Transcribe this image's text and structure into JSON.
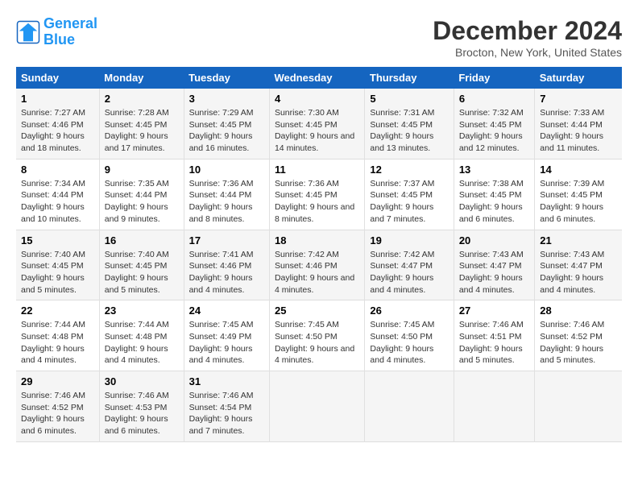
{
  "logo": {
    "line1": "General",
    "line2": "Blue"
  },
  "title": "December 2024",
  "subtitle": "Brocton, New York, United States",
  "days_of_week": [
    "Sunday",
    "Monday",
    "Tuesday",
    "Wednesday",
    "Thursday",
    "Friday",
    "Saturday"
  ],
  "weeks": [
    [
      {
        "day": "1",
        "sunrise": "7:27 AM",
        "sunset": "4:46 PM",
        "daylight": "9 hours and 18 minutes."
      },
      {
        "day": "2",
        "sunrise": "7:28 AM",
        "sunset": "4:45 PM",
        "daylight": "9 hours and 17 minutes."
      },
      {
        "day": "3",
        "sunrise": "7:29 AM",
        "sunset": "4:45 PM",
        "daylight": "9 hours and 16 minutes."
      },
      {
        "day": "4",
        "sunrise": "7:30 AM",
        "sunset": "4:45 PM",
        "daylight": "9 hours and 14 minutes."
      },
      {
        "day": "5",
        "sunrise": "7:31 AM",
        "sunset": "4:45 PM",
        "daylight": "9 hours and 13 minutes."
      },
      {
        "day": "6",
        "sunrise": "7:32 AM",
        "sunset": "4:45 PM",
        "daylight": "9 hours and 12 minutes."
      },
      {
        "day": "7",
        "sunrise": "7:33 AM",
        "sunset": "4:44 PM",
        "daylight": "9 hours and 11 minutes."
      }
    ],
    [
      {
        "day": "8",
        "sunrise": "7:34 AM",
        "sunset": "4:44 PM",
        "daylight": "9 hours and 10 minutes."
      },
      {
        "day": "9",
        "sunrise": "7:35 AM",
        "sunset": "4:44 PM",
        "daylight": "9 hours and 9 minutes."
      },
      {
        "day": "10",
        "sunrise": "7:36 AM",
        "sunset": "4:44 PM",
        "daylight": "9 hours and 8 minutes."
      },
      {
        "day": "11",
        "sunrise": "7:36 AM",
        "sunset": "4:45 PM",
        "daylight": "9 hours and 8 minutes."
      },
      {
        "day": "12",
        "sunrise": "7:37 AM",
        "sunset": "4:45 PM",
        "daylight": "9 hours and 7 minutes."
      },
      {
        "day": "13",
        "sunrise": "7:38 AM",
        "sunset": "4:45 PM",
        "daylight": "9 hours and 6 minutes."
      },
      {
        "day": "14",
        "sunrise": "7:39 AM",
        "sunset": "4:45 PM",
        "daylight": "9 hours and 6 minutes."
      }
    ],
    [
      {
        "day": "15",
        "sunrise": "7:40 AM",
        "sunset": "4:45 PM",
        "daylight": "9 hours and 5 minutes."
      },
      {
        "day": "16",
        "sunrise": "7:40 AM",
        "sunset": "4:45 PM",
        "daylight": "9 hours and 5 minutes."
      },
      {
        "day": "17",
        "sunrise": "7:41 AM",
        "sunset": "4:46 PM",
        "daylight": "9 hours and 4 minutes."
      },
      {
        "day": "18",
        "sunrise": "7:42 AM",
        "sunset": "4:46 PM",
        "daylight": "9 hours and 4 minutes."
      },
      {
        "day": "19",
        "sunrise": "7:42 AM",
        "sunset": "4:47 PM",
        "daylight": "9 hours and 4 minutes."
      },
      {
        "day": "20",
        "sunrise": "7:43 AM",
        "sunset": "4:47 PM",
        "daylight": "9 hours and 4 minutes."
      },
      {
        "day": "21",
        "sunrise": "7:43 AM",
        "sunset": "4:47 PM",
        "daylight": "9 hours and 4 minutes."
      }
    ],
    [
      {
        "day": "22",
        "sunrise": "7:44 AM",
        "sunset": "4:48 PM",
        "daylight": "9 hours and 4 minutes."
      },
      {
        "day": "23",
        "sunrise": "7:44 AM",
        "sunset": "4:48 PM",
        "daylight": "9 hours and 4 minutes."
      },
      {
        "day": "24",
        "sunrise": "7:45 AM",
        "sunset": "4:49 PM",
        "daylight": "9 hours and 4 minutes."
      },
      {
        "day": "25",
        "sunrise": "7:45 AM",
        "sunset": "4:50 PM",
        "daylight": "9 hours and 4 minutes."
      },
      {
        "day": "26",
        "sunrise": "7:45 AM",
        "sunset": "4:50 PM",
        "daylight": "9 hours and 4 minutes."
      },
      {
        "day": "27",
        "sunrise": "7:46 AM",
        "sunset": "4:51 PM",
        "daylight": "9 hours and 5 minutes."
      },
      {
        "day": "28",
        "sunrise": "7:46 AM",
        "sunset": "4:52 PM",
        "daylight": "9 hours and 5 minutes."
      }
    ],
    [
      {
        "day": "29",
        "sunrise": "7:46 AM",
        "sunset": "4:52 PM",
        "daylight": "9 hours and 6 minutes."
      },
      {
        "day": "30",
        "sunrise": "7:46 AM",
        "sunset": "4:53 PM",
        "daylight": "9 hours and 6 minutes."
      },
      {
        "day": "31",
        "sunrise": "7:46 AM",
        "sunset": "4:54 PM",
        "daylight": "9 hours and 7 minutes."
      },
      null,
      null,
      null,
      null
    ]
  ]
}
